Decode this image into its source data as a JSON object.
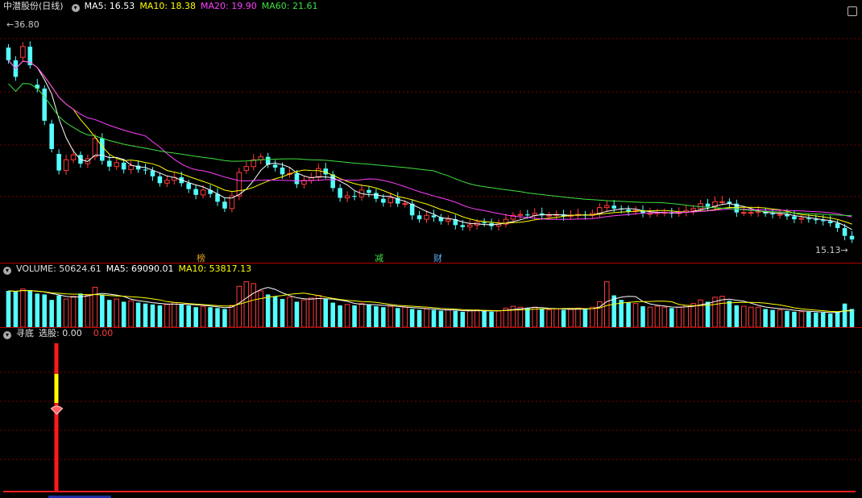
{
  "header": {
    "stock": "中潜股份(日线)",
    "ma5": "MA5: 16.53",
    "ma10": "MA10: 18.38",
    "ma20": "MA20: 19.90",
    "ma60": "MA60: 21.61",
    "high_label": "36.80",
    "low_label": "15.13"
  },
  "events": [
    {
      "label": "榜",
      "color": "#e0a020"
    },
    {
      "label": "减",
      "color": "#40e040"
    },
    {
      "label": "财",
      "color": "#60b0ff"
    }
  ],
  "volume_header": {
    "vol": "VOLUME: 50624.61",
    "ma5": "MA5: 69090.01",
    "ma10": "MA10: 53817.13"
  },
  "indicator_header": {
    "name": "寻底",
    "pick": "选股: 0.00",
    "value": "0.00"
  },
  "colors": {
    "up": "#ff3b3b",
    "down": "#54ffff",
    "ma5": "#ffffff",
    "ma10": "#ffff00",
    "ma20": "#ff40ff",
    "ma60": "#40e040",
    "grid": "#7a0000"
  },
  "chart_data": {
    "type": "candlestick",
    "price_range": [
      15.13,
      36.8
    ],
    "closes": [
      33.5,
      31.8,
      34.9,
      33.0,
      30.6,
      27.3,
      24.4,
      22.2,
      23.3,
      23.8,
      22.9,
      23.4,
      25.5,
      23.2,
      22.6,
      23.0,
      22.3,
      22.7,
      22.3,
      22.2,
      21.6,
      20.9,
      21.2,
      21.5,
      20.9,
      20.3,
      19.7,
      20.2,
      19.8,
      19.0,
      18.3,
      19.6,
      22.0,
      22.6,
      23.3,
      23.6,
      22.8,
      22.5,
      21.8,
      21.9,
      20.8,
      21.2,
      21.5,
      22.4,
      21.8,
      20.4,
      19.4,
      19.6,
      19.5,
      20.2,
      19.9,
      19.3,
      18.9,
      19.4,
      18.8,
      18.8,
      17.6,
      17.2,
      17.6,
      17.4,
      17.0,
      17.2,
      16.6,
      16.4,
      16.6,
      16.9,
      16.8,
      16.5,
      16.7,
      17.2,
      17.6,
      17.7,
      17.6,
      17.8,
      17.6,
      17.6,
      17.7,
      17.5,
      17.6,
      17.7,
      17.6,
      17.8,
      18.4,
      18.6,
      18.3,
      18.2,
      18.0,
      18.1,
      17.8,
      17.8,
      17.9,
      17.9,
      17.8,
      17.9,
      18.1,
      18.3,
      18.8,
      18.5,
      19.0,
      19.0,
      18.8,
      17.9,
      17.9,
      17.9,
      18.0,
      17.8,
      17.7,
      17.7,
      17.5,
      17.2,
      17.3,
      17.2,
      17.1,
      17.0,
      16.8,
      16.3,
      15.5,
      15.13
    ],
    "opens": [
      34.8,
      33.5,
      33.8,
      34.9,
      31.0,
      30.6,
      27.0,
      23.9,
      22.2,
      23.3,
      23.8,
      22.9,
      23.6,
      25.5,
      23.2,
      22.6,
      23.0,
      22.3,
      22.7,
      22.3,
      22.2,
      21.6,
      20.9,
      21.2,
      21.5,
      20.9,
      20.3,
      19.7,
      20.2,
      19.8,
      19.0,
      18.3,
      19.6,
      22.2,
      22.6,
      23.3,
      23.6,
      22.8,
      22.5,
      21.8,
      21.9,
      20.8,
      21.2,
      21.5,
      22.4,
      21.8,
      20.4,
      19.4,
      19.6,
      19.5,
      20.2,
      19.9,
      19.3,
      18.9,
      19.4,
      18.8,
      18.8,
      17.6,
      17.2,
      17.6,
      17.4,
      17.0,
      17.2,
      16.6,
      16.4,
      16.6,
      16.9,
      16.8,
      16.5,
      16.7,
      17.2,
      17.6,
      17.7,
      17.6,
      17.8,
      17.6,
      17.6,
      17.7,
      17.5,
      17.6,
      17.7,
      17.6,
      17.8,
      18.4,
      18.6,
      18.3,
      18.2,
      18.0,
      18.1,
      17.8,
      17.8,
      17.9,
      17.9,
      17.8,
      17.9,
      18.1,
      18.3,
      18.8,
      18.5,
      19.0,
      19.0,
      18.8,
      17.9,
      17.9,
      17.9,
      18.0,
      17.8,
      17.7,
      17.7,
      17.5,
      17.2,
      17.3,
      17.2,
      17.1,
      17.0,
      16.8,
      16.3,
      15.5
    ],
    "volumes": [
      80,
      78,
      84,
      80,
      74,
      72,
      60,
      70,
      62,
      68,
      74,
      70,
      88,
      72,
      60,
      62,
      56,
      58,
      54,
      52,
      50,
      48,
      50,
      54,
      50,
      48,
      44,
      46,
      44,
      42,
      40,
      48,
      90,
      100,
      96,
      80,
      72,
      68,
      62,
      66,
      56,
      60,
      64,
      70,
      62,
      54,
      48,
      50,
      48,
      52,
      50,
      46,
      44,
      46,
      42,
      44,
      40,
      38,
      40,
      38,
      36,
      38,
      36,
      34,
      36,
      38,
      36,
      34,
      36,
      42,
      46,
      44,
      42,
      44,
      40,
      38,
      40,
      38,
      40,
      42,
      40,
      44,
      56,
      100,
      70,
      60,
      54,
      52,
      46,
      44,
      46,
      44,
      42,
      44,
      48,
      52,
      60,
      56,
      66,
      68,
      58,
      48,
      46,
      44,
      44,
      40,
      38,
      38,
      36,
      34,
      34,
      34,
      32,
      32,
      30,
      34,
      52,
      40
    ],
    "ma5_last": 16.53,
    "ma10_last": 18.38,
    "ma20_last": 19.9,
    "ma60_last": 21.61,
    "indicator_signal_index": 0
  }
}
